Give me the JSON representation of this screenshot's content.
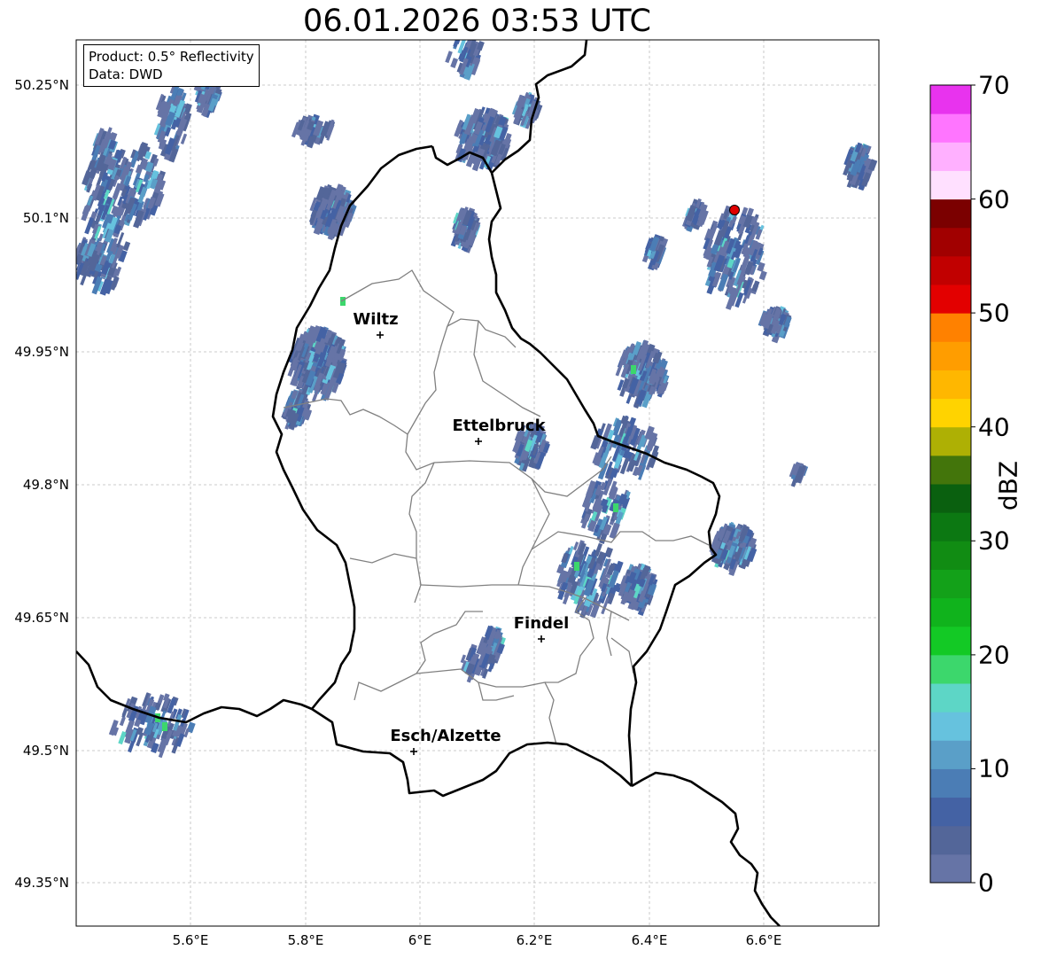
{
  "title": "06.01.2026 03:53 UTC",
  "info": {
    "product": "Product: 0.5° Reflectivity",
    "data": "Data: DWD"
  },
  "colorbar": {
    "unit": "dBZ",
    "ticks": [
      "70",
      "60",
      "50",
      "40",
      "30",
      "20",
      "10",
      "0"
    ],
    "colors": [
      "#6674a6",
      "#536699",
      "#4462a4",
      "#4b7db5",
      "#5a9fc8",
      "#66c2de",
      "#5dd6c6",
      "#3cd76c",
      "#13c925",
      "#10b31c",
      "#13a119",
      "#118c13",
      "#0c7812",
      "#0a600f",
      "#43750b",
      "#aeb004",
      "#ffd300",
      "#ffb700",
      "#ff9d00",
      "#ff8100",
      "#e30000",
      "#c10000",
      "#a10000",
      "#7b0000",
      "#ffe0ff",
      "#ffb0ff",
      "#ff75ff",
      "#e833ee"
    ]
  },
  "axes": {
    "lat_labels": [
      "50.25°N",
      "50.1°N",
      "49.95°N",
      "49.8°N",
      "49.65°N",
      "49.5°N",
      "49.35°N"
    ],
    "lon_labels": [
      "5.6°E",
      "5.8°E",
      "6°E",
      "6.2°E",
      "6.4°E",
      "6.6°E"
    ]
  },
  "cities": [
    {
      "name": "Wiltz"
    },
    {
      "name": "Ettelbruck"
    },
    {
      "name": "Findel"
    },
    {
      "name": "Esch/Alzette"
    }
  ],
  "colors": {
    "border": "#000000",
    "district": "#808080",
    "grid": "#bbbbbb",
    "radar_site": "#e00000"
  }
}
